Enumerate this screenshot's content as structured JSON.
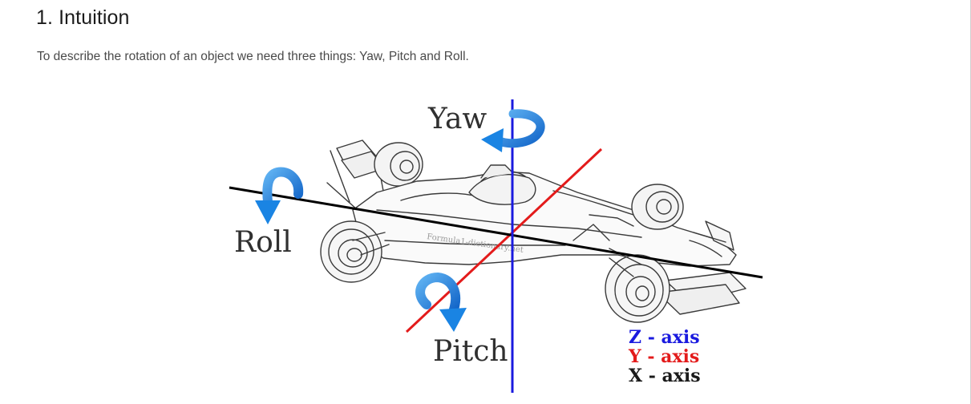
{
  "article": {
    "heading": "1. Intuition",
    "intro": "To describe the rotation of an object we need three things: Yaw, Pitch and Roll."
  },
  "diagram": {
    "labels": {
      "yaw": "Yaw",
      "roll": "Roll",
      "pitch": "Pitch"
    },
    "watermark": "Formula1-dictionary.net",
    "legend": {
      "z": "Z - axis",
      "y": "Y - axis",
      "x": "X - axis"
    },
    "colors": {
      "z_axis": "#1a1adf",
      "y_axis": "#e31b1b",
      "x_axis": "#000000",
      "rotation_arrow": "#1a84e3"
    }
  }
}
